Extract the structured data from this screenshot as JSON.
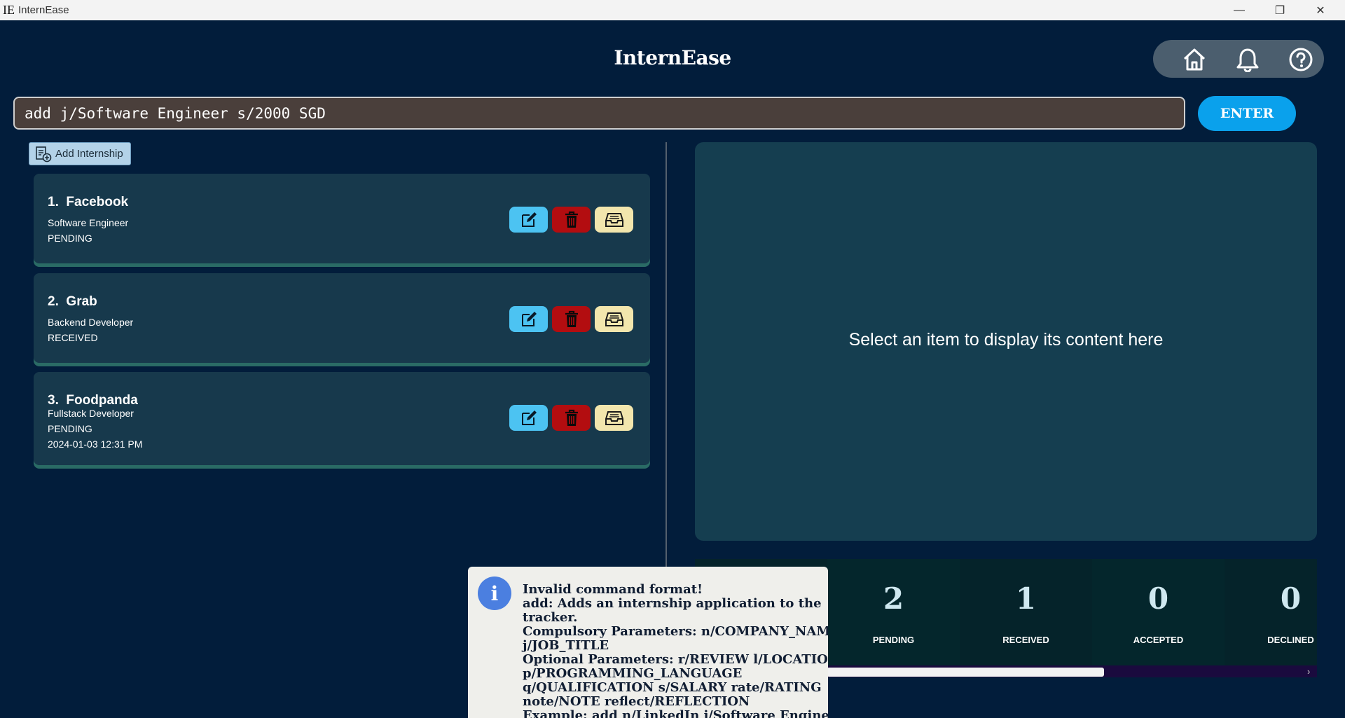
{
  "window": {
    "logo": "IE",
    "title": "InternEase",
    "controls": {
      "minimize": "—",
      "maximize": "❐",
      "close": "✕"
    }
  },
  "app": {
    "title": "InternEase"
  },
  "nav": {
    "icons": [
      "home-icon",
      "bell-icon",
      "help-icon"
    ]
  },
  "command": {
    "value": "add j/Software Engineer s/2000 SGD",
    "enter_label": "ENTER"
  },
  "add_button": {
    "label": "Add Internship"
  },
  "internships": [
    {
      "index": "1.",
      "company": "Facebook",
      "role": "Software Engineer",
      "status": "PENDING",
      "date": ""
    },
    {
      "index": "2.",
      "company": "Grab",
      "role": "Backend Developer",
      "status": "RECEIVED",
      "date": ""
    },
    {
      "index": "3.",
      "company": "Foodpanda",
      "role": "Fullstack Developer",
      "status": "PENDING",
      "date": "2024-01-03 12:31 PM"
    }
  ],
  "detail": {
    "placeholder": "Select an item to display its content here"
  },
  "stats": [
    {
      "count": "2",
      "label": "PENDING"
    },
    {
      "count": "1",
      "label": "RECEIVED"
    },
    {
      "count": "0",
      "label": "ACCEPTED"
    },
    {
      "count": "0",
      "label": "DECLINED"
    }
  ],
  "toast": {
    "lines": [
      "Invalid command format!",
      "add: Adds an internship application to the",
      "tracker.",
      "Compulsory Parameters: n/COMPANY_NAME",
      "j/JOB_TITLE",
      "Optional Parameters: r/REVIEW l/LOCATION",
      "p/PROGRAMMING_LANGUAGE",
      "q/QUALIFICATION s/SALARY rate/RATING",
      "note/NOTE reflect/REFLECTION",
      "Example: add n/LinkedIn j/Software Engineer"
    ]
  },
  "colors": {
    "background": "#021d3b",
    "card": "#17394c",
    "accent": "#0aa1ec",
    "edit": "#4cc3f2",
    "delete": "#b30d10",
    "archive": "#f2e6ad"
  }
}
